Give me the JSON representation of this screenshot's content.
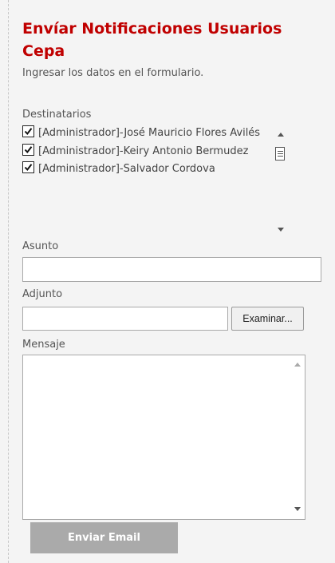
{
  "form": {
    "title": "Envíar Notificaciones Usuarios Cepa",
    "subtitle": "Ingresar los datos en el formulario.",
    "recipients_label": "Destinatarios",
    "recipients": [
      {
        "label": "[Administrador]-José Mauricio Flores Avilés",
        "checked": true
      },
      {
        "label": "[Administrador]-Keiry Antonio Bermudez",
        "checked": true
      },
      {
        "label": "[Administrador]-Salvador Cordova",
        "checked": true
      }
    ],
    "subject_label": "Asunto",
    "subject_value": "",
    "attachment_label": "Adjunto",
    "attachment_value": "",
    "browse_label": "Examinar...",
    "message_label": "Mensaje",
    "message_value": "",
    "submit_label": "Enviar Email"
  },
  "colors": {
    "title": "#c00000",
    "button_bg": "#aaaaaa"
  }
}
